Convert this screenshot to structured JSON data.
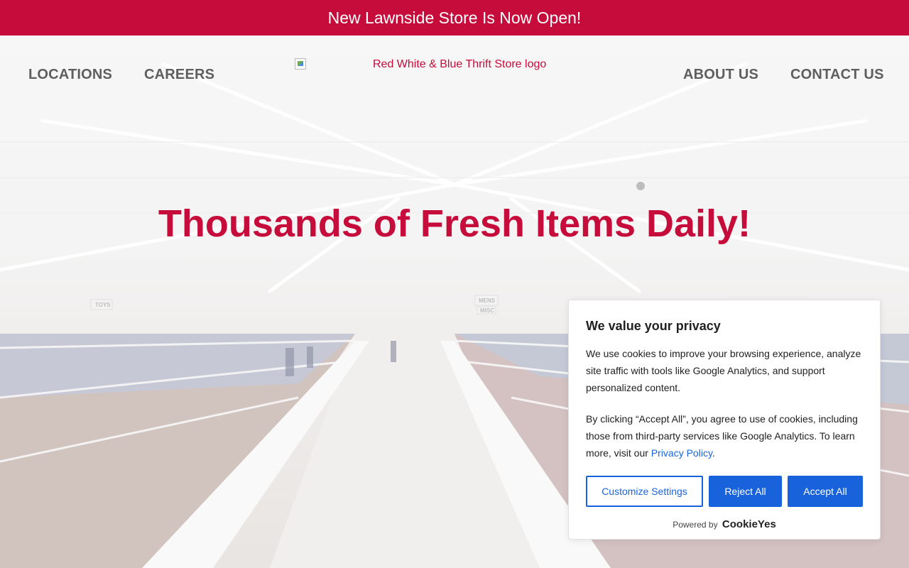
{
  "announcement": {
    "text": "New Lawnside Store Is Now Open!"
  },
  "nav": {
    "locations": "LOCATIONS",
    "careers": "CAREERS",
    "about": "ABOUT US",
    "contact": "CONTACT US"
  },
  "logo": {
    "alt_text": "Red White & Blue Thrift Store logo"
  },
  "hero": {
    "headline": "Thousands of Fresh Items Daily!",
    "signs": [
      "TOYS",
      "MENS",
      "MISC"
    ]
  },
  "cookie_banner": {
    "title": "We value your privacy",
    "paragraph1": "We use cookies to improve your browsing experience, analyze site traffic with tools like Google Analytics, and support personalized content.",
    "paragraph2_prefix": "By clicking “Accept All”, you agree to use of cookies, including those from third-party services like Google Analytics. To learn more, visit our ",
    "privacy_link": "Privacy Policy",
    "paragraph2_suffix": ".",
    "customize_label": "Customize Settings",
    "reject_label": "Reject All",
    "accept_label": "Accept All",
    "powered_by": "Powered by",
    "brand": "CookieYes"
  },
  "colors": {
    "brand_red": "#c60c3a",
    "nav_gray": "#5e5e5e",
    "button_blue": "#1863dc"
  }
}
